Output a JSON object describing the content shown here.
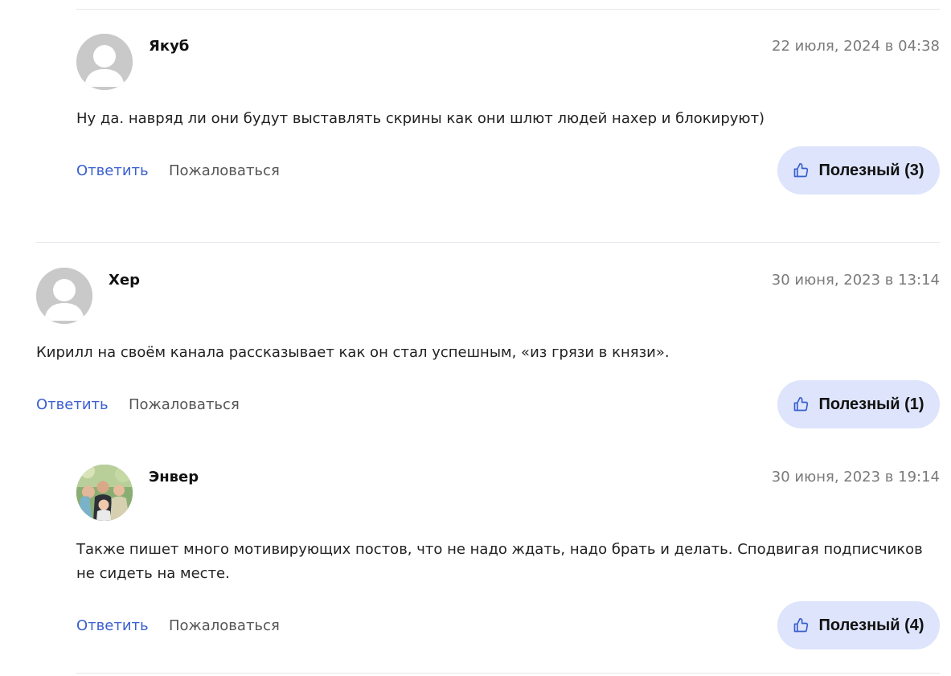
{
  "comments": [
    {
      "author": "Якуб",
      "date": "22 июля, 2024 в 04:38",
      "text": "Ну да. навряд ли они будут выставлять скрины как они шлют людей нахер и блокируют)",
      "reply_label": "Ответить",
      "report_label": "Пожаловаться",
      "useful_label": "Полезный (3)",
      "avatar": "default-avatar-icon"
    },
    {
      "author": "Хер",
      "date": "30 июня, 2023 в 13:14",
      "text": "Кирилл на своём канала рассказывает как он стал успешным, «из грязи в князи».",
      "reply_label": "Ответить",
      "report_label": "Пожаловаться",
      "useful_label": "Полезный (1)",
      "avatar": "default-avatar-icon"
    },
    {
      "author": "Энвер",
      "date": "30 июня, 2023 в 19:14",
      "text": "Также пишет много мотивирующих постов, что не надо ждать, надо брать и делать. Сподвигая подписчиков не сидеть на месте.",
      "reply_label": "Ответить",
      "report_label": "Пожаловаться",
      "useful_label": "Полезный (4)",
      "avatar": "family-photo-avatar"
    }
  ],
  "colors": {
    "link": "#3a5fcf",
    "useful_bg": "#dde4fb",
    "divider": "#e6e8ee",
    "avatar_default": "#c9c9c9"
  }
}
